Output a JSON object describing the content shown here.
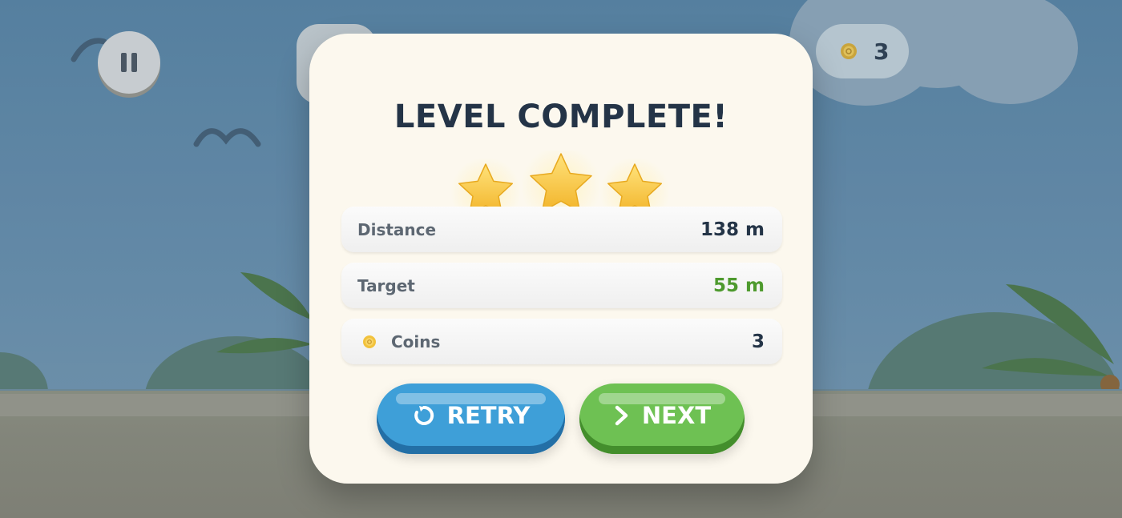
{
  "hud": {
    "coin_count": "3",
    "pause_icon": "pause-icon",
    "coin_icon": "coin-icon"
  },
  "modal": {
    "title": "LEVEL COMPLETE!",
    "stars_earned": 3,
    "stars_total": 3,
    "stats": [
      {
        "label": "Distance",
        "value": "138 m"
      },
      {
        "label": "Target",
        "value": "55 m"
      },
      {
        "label": "Coins",
        "value": "3",
        "icon": "coin-icon"
      }
    ],
    "buttons": {
      "retry": {
        "label": "RETRY",
        "icon": "retry-icon"
      },
      "next": {
        "label": "NEXT",
        "icon": "chevron-right-icon"
      }
    }
  },
  "colors": {
    "title": "#243447",
    "target_value": "#4e9a2e",
    "retry_button": "#3e9fd8",
    "next_button": "#6ec153",
    "star": "#f7c534",
    "panel": "#fcf8ee"
  }
}
